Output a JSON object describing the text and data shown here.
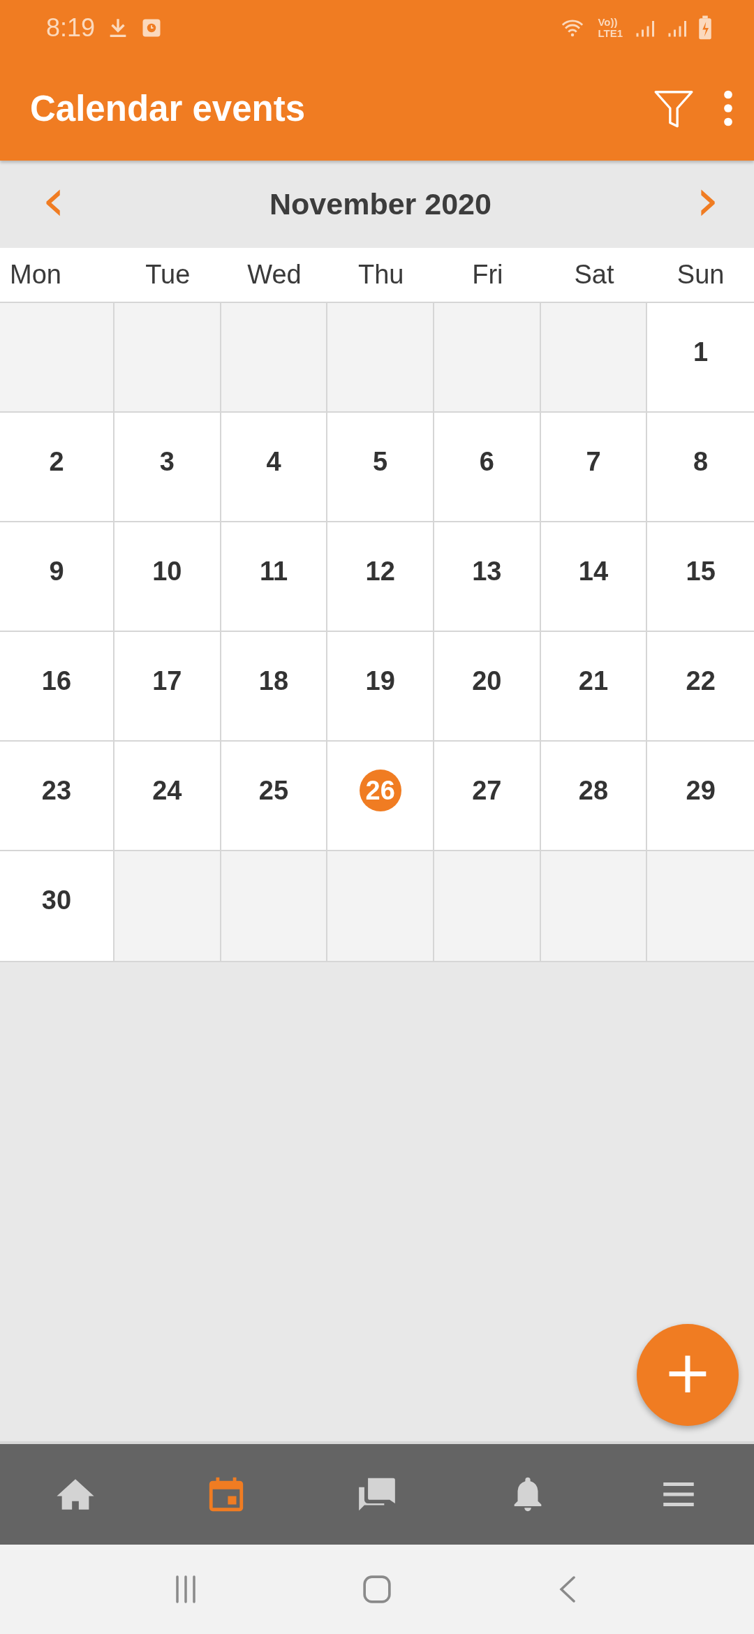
{
  "status_bar": {
    "time": "8:19",
    "network_top": "Vo))",
    "network_bottom": "LTE1"
  },
  "app_bar": {
    "title": "Calendar events"
  },
  "month_nav": {
    "prev": "‹",
    "label": "November 2020",
    "next": "›"
  },
  "weekdays": [
    "Mon",
    "Tue",
    "Wed",
    "Thu",
    "Fri",
    "Sat",
    "Sun"
  ],
  "weeks": [
    [
      {
        "kind": "blank"
      },
      {
        "kind": "blank"
      },
      {
        "kind": "blank"
      },
      {
        "kind": "blank"
      },
      {
        "kind": "blank"
      },
      {
        "kind": "blank"
      },
      {
        "kind": "day",
        "day": "1",
        "selected": false
      }
    ],
    [
      {
        "kind": "day",
        "day": "2",
        "selected": false
      },
      {
        "kind": "day",
        "day": "3",
        "selected": false
      },
      {
        "kind": "day",
        "day": "4",
        "selected": false
      },
      {
        "kind": "day",
        "day": "5",
        "selected": false
      },
      {
        "kind": "day",
        "day": "6",
        "selected": false
      },
      {
        "kind": "day",
        "day": "7",
        "selected": false
      },
      {
        "kind": "day",
        "day": "8",
        "selected": false
      }
    ],
    [
      {
        "kind": "day",
        "day": "9",
        "selected": false
      },
      {
        "kind": "day",
        "day": "10",
        "selected": false
      },
      {
        "kind": "day",
        "day": "11",
        "selected": false
      },
      {
        "kind": "day",
        "day": "12",
        "selected": false
      },
      {
        "kind": "day",
        "day": "13",
        "selected": false
      },
      {
        "kind": "day",
        "day": "14",
        "selected": false
      },
      {
        "kind": "day",
        "day": "15",
        "selected": false
      }
    ],
    [
      {
        "kind": "day",
        "day": "16",
        "selected": false
      },
      {
        "kind": "day",
        "day": "17",
        "selected": false
      },
      {
        "kind": "day",
        "day": "18",
        "selected": false
      },
      {
        "kind": "day",
        "day": "19",
        "selected": false
      },
      {
        "kind": "day",
        "day": "20",
        "selected": false
      },
      {
        "kind": "day",
        "day": "21",
        "selected": false
      },
      {
        "kind": "day",
        "day": "22",
        "selected": false
      }
    ],
    [
      {
        "kind": "day",
        "day": "23",
        "selected": false
      },
      {
        "kind": "day",
        "day": "24",
        "selected": false
      },
      {
        "kind": "day",
        "day": "25",
        "selected": false
      },
      {
        "kind": "day",
        "day": "26",
        "selected": true
      },
      {
        "kind": "day",
        "day": "27",
        "selected": false
      },
      {
        "kind": "day",
        "day": "28",
        "selected": false
      },
      {
        "kind": "day",
        "day": "29",
        "selected": false
      }
    ],
    [
      {
        "kind": "day",
        "day": "30",
        "selected": false
      },
      {
        "kind": "blank"
      },
      {
        "kind": "blank"
      },
      {
        "kind": "blank"
      },
      {
        "kind": "blank"
      },
      {
        "kind": "blank"
      },
      {
        "kind": "blank"
      }
    ]
  ],
  "fab": {
    "label": "+"
  },
  "bottom_nav": [
    {
      "kind": "home",
      "selected": false
    },
    {
      "kind": "calendar",
      "selected": true
    },
    {
      "kind": "chat",
      "selected": false
    },
    {
      "kind": "bell",
      "selected": false
    },
    {
      "kind": "menu",
      "selected": false
    }
  ]
}
